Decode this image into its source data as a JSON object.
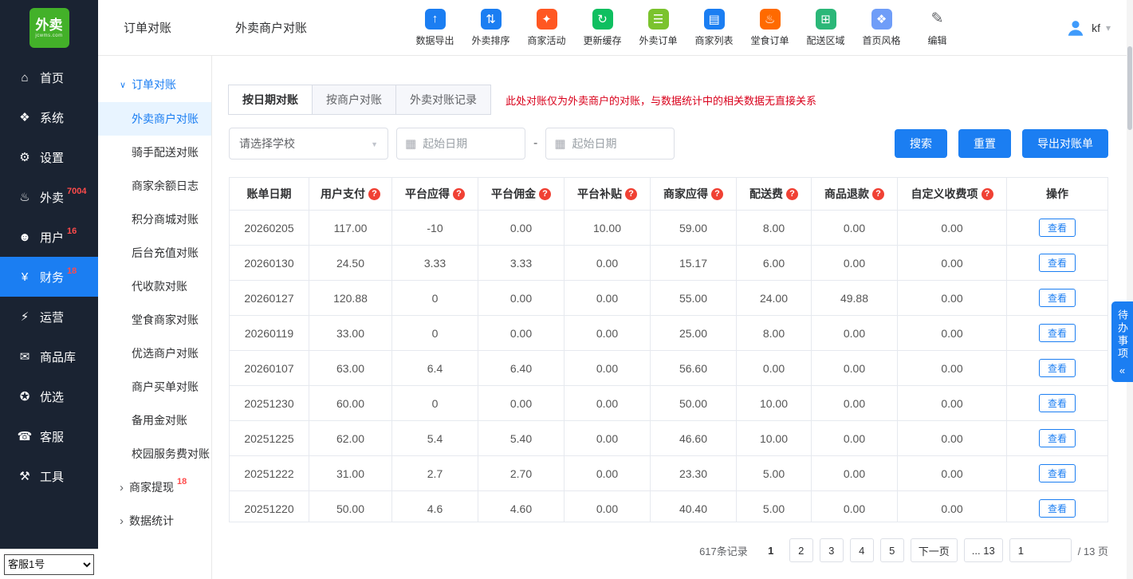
{
  "sidebar": {
    "logo": {
      "text": "外卖",
      "sub": "jcwms.com"
    },
    "items": [
      {
        "icon": "home-icon",
        "glyph": "⌂",
        "label": "首页"
      },
      {
        "icon": "system-icon",
        "glyph": "❖",
        "label": "系统"
      },
      {
        "icon": "settings-icon",
        "glyph": "⚙",
        "label": "设置"
      },
      {
        "icon": "takeout-icon",
        "glyph": "♨",
        "label": "外卖",
        "badge": "7004"
      },
      {
        "icon": "user-icon",
        "glyph": "☻",
        "label": "用户",
        "badge": "16"
      },
      {
        "icon": "finance-icon",
        "glyph": "¥",
        "label": "财务",
        "badge": "18",
        "active": true
      },
      {
        "icon": "operations-icon",
        "glyph": "⚡",
        "label": "运营"
      },
      {
        "icon": "products-icon",
        "glyph": "✉",
        "label": "商品库"
      },
      {
        "icon": "preferred-icon",
        "glyph": "✪",
        "label": "优选"
      },
      {
        "icon": "service-icon",
        "glyph": "☎",
        "label": "客服"
      },
      {
        "icon": "tools-icon",
        "glyph": "⚒",
        "label": "工具"
      }
    ],
    "agent_select": {
      "value": "客服1号"
    }
  },
  "header": {
    "submenu_title": "订单对账",
    "page_title": "外卖商户对账",
    "tools": [
      {
        "name": "data-export",
        "icon": "data-export-icon",
        "label": "数据导出",
        "glyph": "↑",
        "color": "#1b7ef2"
      },
      {
        "name": "takeout-sort",
        "icon": "takeout-sort-icon",
        "label": "外卖排序",
        "glyph": "⇅",
        "color": "#1b7ef2"
      },
      {
        "name": "merchant-activity",
        "icon": "merchant-activity-icon",
        "label": "商家活动",
        "glyph": "✦",
        "color": "#ff5722"
      },
      {
        "name": "refresh-cache",
        "icon": "refresh-cache-icon",
        "label": "更新缓存",
        "glyph": "↻",
        "color": "#0fbf60"
      },
      {
        "name": "takeout-orders",
        "icon": "takeout-orders-icon",
        "label": "外卖订单",
        "glyph": "☰",
        "color": "#7bc32e"
      },
      {
        "name": "merchant-list",
        "icon": "merchant-list-icon",
        "label": "商家列表",
        "glyph": "▤",
        "color": "#1b7ef2"
      },
      {
        "name": "dinein-orders",
        "icon": "dinein-orders-icon",
        "label": "堂食订单",
        "glyph": "♨",
        "color": "#ff6a00"
      },
      {
        "name": "delivery-area",
        "icon": "delivery-area-icon",
        "label": "配送区域",
        "glyph": "⊞",
        "color": "#2bb778"
      },
      {
        "name": "homepage-style",
        "icon": "homepage-style-icon",
        "label": "首页风格",
        "glyph": "❖",
        "color": "#6f9df8"
      },
      {
        "name": "edit",
        "icon": "edit-icon",
        "label": "编辑",
        "glyph": "✎",
        "flat": true
      }
    ],
    "user": {
      "name": "kf"
    }
  },
  "submenu": {
    "parent": {
      "label": "订单对账"
    },
    "items": [
      {
        "label": "外卖商户对账",
        "active": true
      },
      {
        "label": "骑手配送对账"
      },
      {
        "label": "商家余额日志"
      },
      {
        "label": "积分商城对账"
      },
      {
        "label": "后台充值对账"
      },
      {
        "label": "代收款对账"
      },
      {
        "label": "堂食商家对账"
      },
      {
        "label": "优选商户对账"
      },
      {
        "label": "商户买单对账"
      },
      {
        "label": "备用金对账"
      },
      {
        "label": "校园服务费对账"
      }
    ],
    "collapsed": [
      {
        "label": "商家提现",
        "badge": "18"
      },
      {
        "label": "数据统计"
      }
    ]
  },
  "main": {
    "tabs": [
      {
        "label": "按日期对账",
        "active": true
      },
      {
        "label": "按商户对账"
      },
      {
        "label": "外卖对账记录"
      }
    ],
    "notice": "此处对账仅为外卖商户的对账，与数据统计中的相关数据无直接关系",
    "filters": {
      "school_placeholder": "请选择学校",
      "date_start_placeholder": "起始日期",
      "date_end_placeholder": "起始日期",
      "separator": "-",
      "search_label": "搜索",
      "reset_label": "重置",
      "export_label": "导出对账单"
    },
    "table": {
      "columns": [
        {
          "label": "账单日期"
        },
        {
          "label": "用户支付",
          "help": true
        },
        {
          "label": "平台应得",
          "help": true
        },
        {
          "label": "平台佣金",
          "help": true
        },
        {
          "label": "平台补贴",
          "help": true
        },
        {
          "label": "商家应得",
          "help": true
        },
        {
          "label": "配送费",
          "help": true
        },
        {
          "label": "商品退款",
          "help": true
        },
        {
          "label": "自定义收费项",
          "help": true
        },
        {
          "label": "操作"
        }
      ],
      "action_label": "查看",
      "rows": [
        [
          "20260205",
          "117.00",
          "-10",
          "0.00",
          "10.00",
          "59.00",
          "8.00",
          "0.00",
          "0.00"
        ],
        [
          "20260130",
          "24.50",
          "3.33",
          "3.33",
          "0.00",
          "15.17",
          "6.00",
          "0.00",
          "0.00"
        ],
        [
          "20260127",
          "120.88",
          "0",
          "0.00",
          "0.00",
          "55.00",
          "24.00",
          "49.88",
          "0.00"
        ],
        [
          "20260119",
          "33.00",
          "0",
          "0.00",
          "0.00",
          "25.00",
          "8.00",
          "0.00",
          "0.00"
        ],
        [
          "20260107",
          "63.00",
          "6.4",
          "6.40",
          "0.00",
          "56.60",
          "0.00",
          "0.00",
          "0.00"
        ],
        [
          "20251230",
          "60.00",
          "0",
          "0.00",
          "0.00",
          "50.00",
          "10.00",
          "0.00",
          "0.00"
        ],
        [
          "20251225",
          "62.00",
          "5.4",
          "5.40",
          "0.00",
          "46.60",
          "10.00",
          "0.00",
          "0.00"
        ],
        [
          "20251222",
          "31.00",
          "2.7",
          "2.70",
          "0.00",
          "23.30",
          "5.00",
          "0.00",
          "0.00"
        ],
        [
          "20251220",
          "50.00",
          "4.6",
          "4.60",
          "0.00",
          "40.40",
          "5.00",
          "0.00",
          "0.00"
        ]
      ]
    },
    "pagination": {
      "total": "617条记录",
      "current": "1",
      "pages": [
        "2",
        "3",
        "4",
        "5"
      ],
      "next_label": "下一页",
      "more_label": "... 13",
      "jump_value": "1",
      "pages_suffix": "/ 13 页"
    }
  },
  "todo": {
    "label": "待办事项",
    "glyph": "«"
  },
  "colors": {
    "primary": "#1b7ef2",
    "sidebar_bg": "#1a2332",
    "danger": "#d9001b",
    "logo_green": "#43b129"
  }
}
